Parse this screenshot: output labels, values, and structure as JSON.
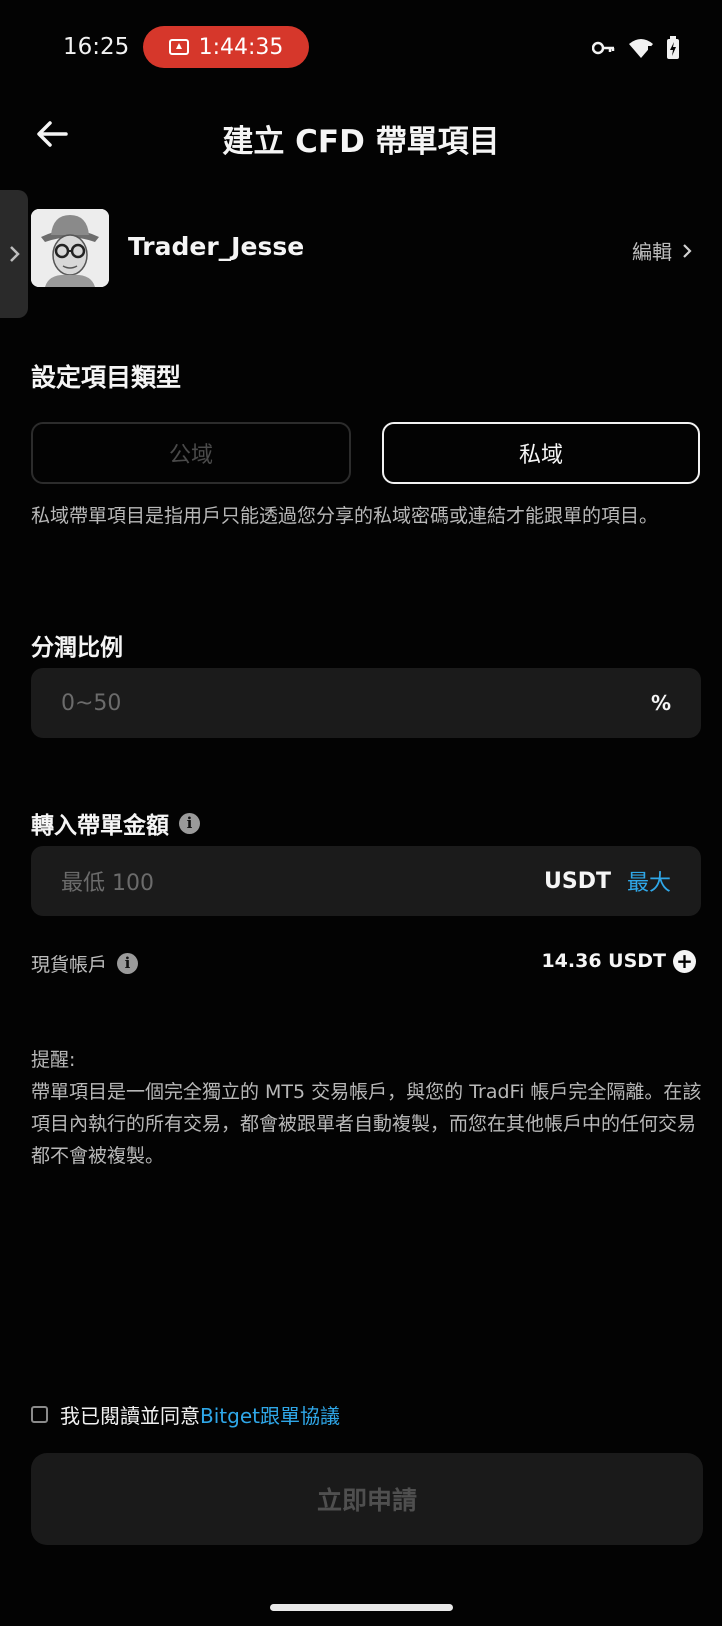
{
  "status_bar": {
    "time": "16:25",
    "recording_timer": "1:44:35",
    "icons": [
      "key-icon",
      "wifi-icon",
      "battery-icon"
    ]
  },
  "header": {
    "title": "建立 CFD 帶單項目",
    "back_icon": "arrow-left-icon"
  },
  "profile": {
    "username": "Trader_Jesse",
    "edit_label": "編輯"
  },
  "project_type": {
    "section_title": "設定項目類型",
    "options": [
      "公域",
      "私域"
    ],
    "selected": "私域",
    "description": "私域帶單項目是指用戶只能透過您分享的私域密碼或連結才能跟單的項目。"
  },
  "profit_share": {
    "label": "分潤比例",
    "placeholder": "0~50",
    "unit": "%"
  },
  "transfer": {
    "label": "轉入帶單金額",
    "placeholder": "最低 100",
    "unit": "USDT",
    "max_label": "最大"
  },
  "spot_account": {
    "label": "現貨帳戶",
    "balance": "14.36 USDT"
  },
  "reminder": {
    "title": "提醒:",
    "text": "帶單項目是一個完全獨立的 MT5 交易帳戶，與您的 TradFi 帳戶完全隔離。在該項目內執行的所有交易，都會被跟單者自動複製，而您在其他帳戶中的任何交易都不會被複製。"
  },
  "agreement": {
    "text": "我已閱讀並同意",
    "link": "Bitget跟單協議",
    "checked": false
  },
  "submit": {
    "label": "立即申請"
  },
  "colors": {
    "background": "#030303",
    "accent_link": "#2fa7e8",
    "record_pill": "#d6372b",
    "input_bg": "#1b1b1b"
  }
}
